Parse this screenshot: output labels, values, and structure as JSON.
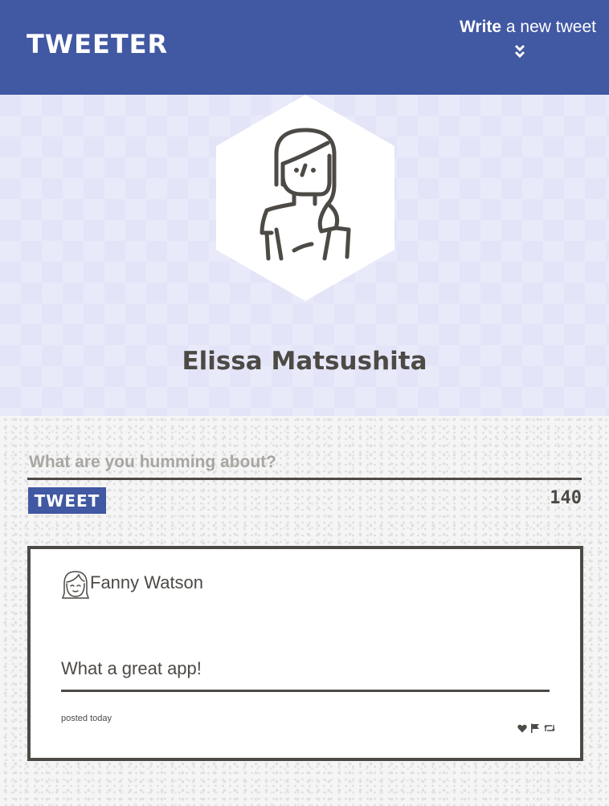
{
  "nav": {
    "logo": "TWEETER",
    "write_bold": "Write",
    "write_rest": "a new tweet",
    "chevron_icon": "double-chevron-down-icon",
    "color": "#4158a2"
  },
  "profile": {
    "name": "Elissa Matsushita",
    "avatar_icon": "woman-avatar-icon"
  },
  "compose": {
    "placeholder": "What are you humming about?",
    "value": "",
    "submit_label": "TWEET",
    "counter": "140"
  },
  "tweets": [
    {
      "author": "Fanny Watson",
      "avatar_icon": "girl-avatar-icon",
      "body": "What a great app!",
      "time": "posted today",
      "actions": [
        "heart-icon",
        "flag-icon",
        "retweet-icon"
      ]
    }
  ]
}
